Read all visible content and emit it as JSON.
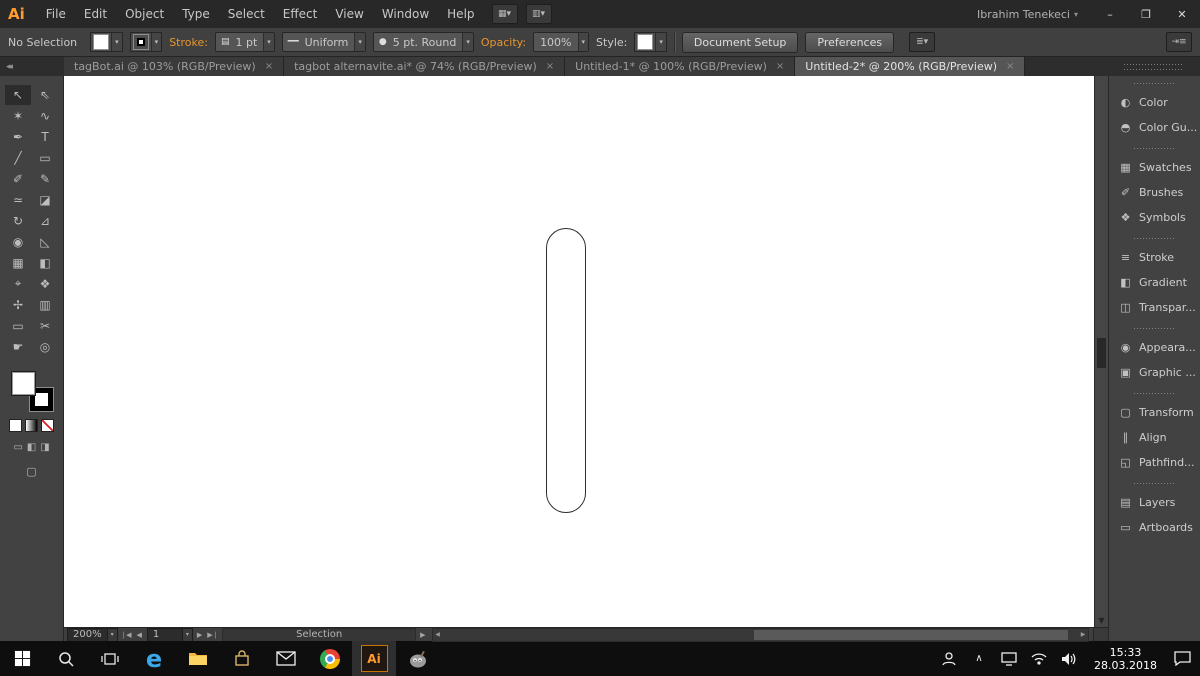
{
  "colors": {
    "accent_orange": "#e8962e",
    "illustrator_orange": "#ff9c2e",
    "canvas_white": "#ffffff",
    "ui_gray": "#404040"
  },
  "menubar": {
    "logo": "Ai",
    "items": [
      "File",
      "Edit",
      "Object",
      "Type",
      "Select",
      "Effect",
      "View",
      "Window",
      "Help"
    ],
    "user": "Ibrahim Tenekeci",
    "window_controls": {
      "minimize": "–",
      "restore": "❐",
      "close": "✕"
    }
  },
  "controlbar": {
    "no_selection": "No Selection",
    "stroke_label": "Stroke:",
    "stroke_width": "1 pt",
    "width_profile": "Uniform",
    "brush": "5 pt. Round",
    "opacity_label": "Opacity:",
    "opacity_value": "100%",
    "style_label": "Style:",
    "document_setup": "Document Setup",
    "preferences": "Preferences"
  },
  "tabbar": {
    "active_index": 3,
    "tabs": [
      {
        "label": "tagBot.ai @ 103% (RGB/Preview)"
      },
      {
        "label": "tagbot alternavite.ai* @ 74% (RGB/Preview)"
      },
      {
        "label": "Untitled-1* @ 100% (RGB/Preview)"
      },
      {
        "label": "Untitled-2* @ 200% (RGB/Preview)"
      }
    ]
  },
  "tools": [
    "selection",
    "direct-selection",
    "magic-wand",
    "lasso",
    "pen",
    "type",
    "line-segment",
    "rectangle",
    "paintbrush",
    "pencil",
    "width",
    "eraser",
    "rotate",
    "scale",
    "shape-builder",
    "perspective-grid",
    "mesh",
    "gradient",
    "eyedropper",
    "blend",
    "symbol-sprayer",
    "column-graph",
    "artboard",
    "slice",
    "hand",
    "zoom"
  ],
  "tool_options": {
    "fill_color": "#ffffff",
    "stroke_color": "#000000"
  },
  "right_panel": {
    "groups": [
      {
        "items": [
          {
            "label": "Color",
            "icon": "color-icon"
          },
          {
            "label": "Color Gu...",
            "icon": "color-guide-icon"
          }
        ]
      },
      {
        "items": [
          {
            "label": "Swatches",
            "icon": "swatches-icon"
          },
          {
            "label": "Brushes",
            "icon": "brushes-icon"
          },
          {
            "label": "Symbols",
            "icon": "symbols-icon"
          }
        ]
      },
      {
        "items": [
          {
            "label": "Stroke",
            "icon": "stroke-icon"
          },
          {
            "label": "Gradient",
            "icon": "gradient-icon"
          },
          {
            "label": "Transpar...",
            "icon": "transparency-icon"
          }
        ]
      },
      {
        "items": [
          {
            "label": "Appeara...",
            "icon": "appearance-icon"
          },
          {
            "label": "Graphic ...",
            "icon": "graphic-styles-icon"
          }
        ]
      },
      {
        "items": [
          {
            "label": "Transform",
            "icon": "transform-icon"
          },
          {
            "label": "Align",
            "icon": "align-icon"
          },
          {
            "label": "Pathfind...",
            "icon": "pathfinder-icon"
          }
        ]
      },
      {
        "items": [
          {
            "label": "Layers",
            "icon": "layers-icon"
          },
          {
            "label": "Artboards",
            "icon": "artboards-icon"
          }
        ]
      }
    ]
  },
  "statusbar": {
    "zoom": "200%",
    "artboard": "1",
    "status": "Selection"
  },
  "taskbar": {
    "illustrator_label": "Ai",
    "time": "15:33",
    "date": "28.03.2018"
  }
}
